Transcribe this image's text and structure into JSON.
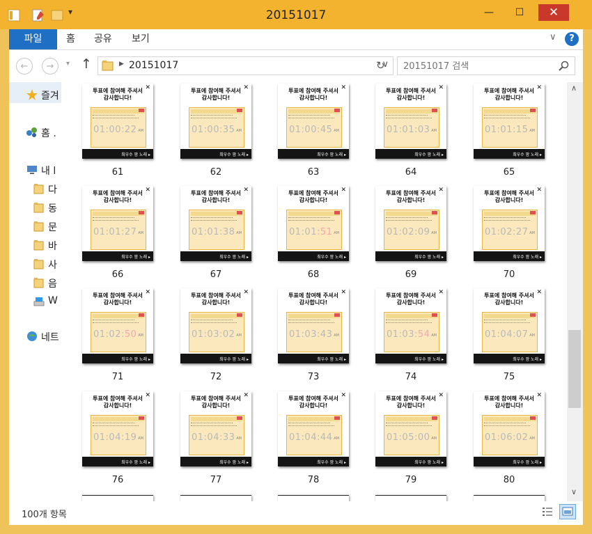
{
  "window": {
    "title": "20151017",
    "minimize_icon": "minimize-icon",
    "maximize_icon": "maximize-icon",
    "close_icon": "close-icon"
  },
  "ribbon": {
    "tabs": [
      "파일",
      "홈",
      "공유",
      "보기"
    ],
    "help_icon": "help-icon"
  },
  "nav": {
    "breadcrumb": "20151017",
    "search_placeholder": "20151017 검색"
  },
  "sidebar": {
    "items": [
      {
        "label": "즐겨",
        "icon": "star-icon"
      },
      {
        "label": "홈 .",
        "icon": "homegroup-icon"
      },
      {
        "label": "내 l",
        "icon": "pc-icon"
      },
      {
        "label": "다",
        "icon": "folder-icon"
      },
      {
        "label": "동",
        "icon": "folder-icon"
      },
      {
        "label": "문",
        "icon": "folder-icon"
      },
      {
        "label": "바",
        "icon": "folder-icon"
      },
      {
        "label": "사",
        "icon": "folder-icon"
      },
      {
        "label": "음",
        "icon": "folder-icon"
      },
      {
        "label": "W",
        "icon": "drive-icon"
      },
      {
        "label": "네트",
        "icon": "network-icon"
      }
    ]
  },
  "thumbnail_text": {
    "message_line1": "투표에 참여해 주셔서",
    "message_line2": "감사합니다!",
    "footer": "최우수 팜 노래 ▸",
    "am": "AM"
  },
  "files": [
    {
      "name": "61",
      "time": "01:00:22",
      "red": false
    },
    {
      "name": "62",
      "time": "01:00:35",
      "red": false
    },
    {
      "name": "63",
      "time": "01:00:45",
      "red": false
    },
    {
      "name": "64",
      "time": "01:01:03",
      "red": false
    },
    {
      "name": "65",
      "time": "01:01:15",
      "red": false
    },
    {
      "name": "66",
      "time": "01:01:27",
      "red": false
    },
    {
      "name": "67",
      "time": "01:01:38",
      "red": false
    },
    {
      "name": "68",
      "time": "01:01:51",
      "red": true
    },
    {
      "name": "69",
      "time": "01:02:09",
      "red": false
    },
    {
      "name": "70",
      "time": "01:02:27",
      "red": false
    },
    {
      "name": "71",
      "time": "01:02:50",
      "red": true
    },
    {
      "name": "72",
      "time": "01:03:02",
      "red": false
    },
    {
      "name": "73",
      "time": "01:03:43",
      "red": false
    },
    {
      "name": "74",
      "time": "01:03:54",
      "red": true
    },
    {
      "name": "75",
      "time": "01:04:07",
      "red": false
    },
    {
      "name": "76",
      "time": "01:04:19",
      "red": false
    },
    {
      "name": "77",
      "time": "01:04:33",
      "red": false
    },
    {
      "name": "78",
      "time": "01:04:44",
      "red": false
    },
    {
      "name": "79",
      "time": "01:05:00",
      "red": false
    },
    {
      "name": "80",
      "time": "01:06:02",
      "red": false
    }
  ],
  "status": {
    "item_count": "100개 항목"
  },
  "colors": {
    "title_bar": "#f4b32e",
    "file_tab": "#1f6fc5",
    "close_button": "#c8382b"
  }
}
